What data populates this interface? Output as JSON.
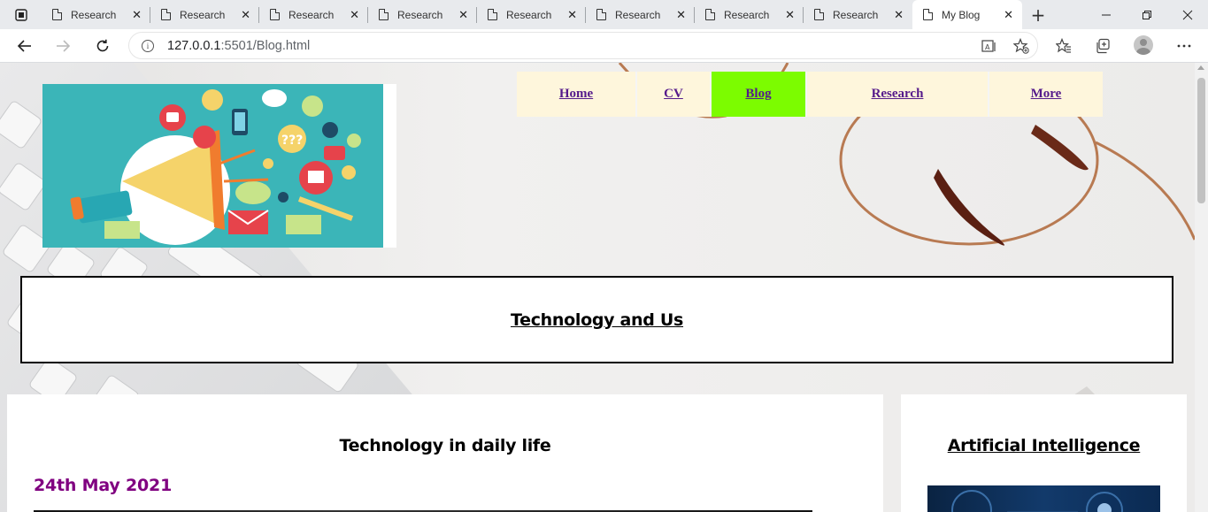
{
  "browser": {
    "tabs": [
      {
        "label": "Research",
        "active": false
      },
      {
        "label": "Research",
        "active": false
      },
      {
        "label": "Research",
        "active": false
      },
      {
        "label": "Research",
        "active": false
      },
      {
        "label": "Research",
        "active": false
      },
      {
        "label": "Research",
        "active": false
      },
      {
        "label": "Research",
        "active": false
      },
      {
        "label": "Research",
        "active": false
      },
      {
        "label": "My Blog",
        "active": true
      }
    ],
    "url_host": "127.0.0.1",
    "url_rest": ":5501/Blog.html",
    "close_glyph": "✕",
    "new_tab_glyph": "+"
  },
  "nav": {
    "items": [
      {
        "label": "Home",
        "active": false
      },
      {
        "label": "CV",
        "active": false
      },
      {
        "label": "Blog",
        "active": true
      },
      {
        "label": "Research",
        "active": false
      },
      {
        "label": "More",
        "active": false
      }
    ],
    "active_color": "#7cfc00",
    "item_color": "#fef6dc",
    "link_color": "#551a8b"
  },
  "page": {
    "site_title": "Technology and Us"
  },
  "main": {
    "post_title": "Technology in daily life",
    "post_date": "24th May 2021",
    "date_color": "#800080"
  },
  "sidebar": {
    "title": "Artificial Intelligence"
  }
}
